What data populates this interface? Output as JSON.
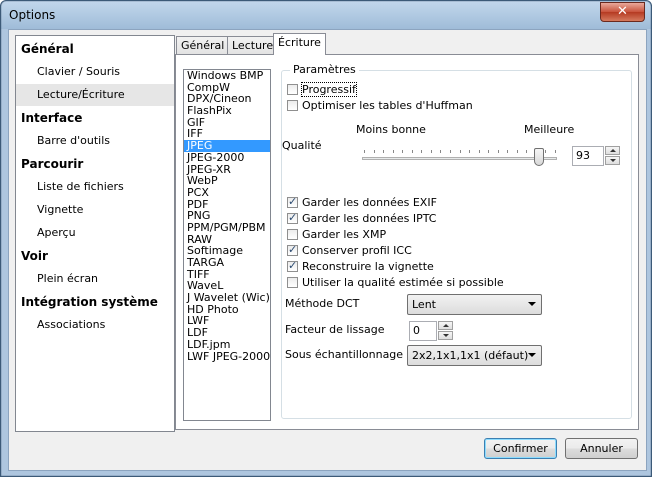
{
  "window": {
    "title": "Options",
    "close_glyph": "✕"
  },
  "sidebar": {
    "groups": [
      {
        "label": "Général",
        "items": [
          "Clavier / Souris",
          "Lecture/Écriture"
        ]
      },
      {
        "label": "Interface",
        "items": [
          "Barre d'outils"
        ]
      },
      {
        "label": "Parcourir",
        "items": [
          "Liste de fichiers",
          "Vignette",
          "Aperçu"
        ]
      },
      {
        "label": "Voir",
        "items": [
          "Plein écran"
        ]
      },
      {
        "label": "Intégration système",
        "items": [
          "Associations"
        ]
      }
    ],
    "selected_item": "Lecture/Écriture"
  },
  "tabs": [
    "Général",
    "Lecture",
    "Écriture"
  ],
  "active_tab": "Écriture",
  "formats": [
    "Windows BMP",
    "CompW",
    "DPX/Cineon",
    "FlashPix",
    "GIF",
    "IFF",
    "JPEG",
    "JPEG-2000",
    "JPEG-XR",
    "WebP",
    "PCX",
    "PDF",
    "PNG",
    "PPM/PGM/PBM",
    "RAW",
    "Softimage",
    "TARGA",
    "TIFF",
    "WaveL",
    "J Wavelet (Wic)",
    "HD Photo",
    "LWF",
    "LDF",
    "LDF.jpm",
    "LWF JPEG-2000"
  ],
  "selected_format": "JPEG",
  "params": {
    "group_label": "Paramètres",
    "progressive": {
      "label": "Progressif",
      "checked": false
    },
    "huffman": {
      "label": "Optimiser les tables d'Huffman",
      "checked": false
    },
    "quality": {
      "label": "Qualité",
      "low_label": "Moins bonne",
      "high_label": "Meilleure",
      "value": "93",
      "slider_fraction": 0.93
    },
    "checkboxes": [
      {
        "label": "Garder les données EXIF",
        "checked": true
      },
      {
        "label": "Garder les données IPTC",
        "checked": true
      },
      {
        "label": "Garder les XMP",
        "checked": false
      },
      {
        "label": "Conserver profil ICC",
        "checked": true
      },
      {
        "label": "Reconstruire la vignette",
        "checked": true
      },
      {
        "label": "Utiliser la qualité estimée si possible",
        "checked": false
      }
    ],
    "dct": {
      "label": "Méthode DCT",
      "value": "Lent"
    },
    "smoothing": {
      "label": "Facteur de lissage",
      "value": "0"
    },
    "subsampling": {
      "label": "Sous échantillonnage",
      "value": "2x2,1x1,1x1 (défaut)"
    }
  },
  "buttons": {
    "ok": "Confirmer",
    "cancel": "Annuler"
  }
}
